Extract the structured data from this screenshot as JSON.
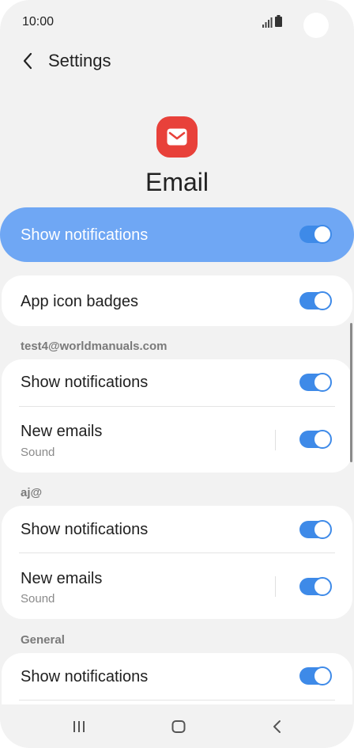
{
  "status_bar": {
    "time": "10:00"
  },
  "header": {
    "title": "Settings"
  },
  "app": {
    "name": "Email"
  },
  "master": {
    "label": "Show notifications",
    "enabled": true
  },
  "badges": {
    "label": "App icon badges",
    "enabled": true
  },
  "sections": [
    {
      "header": "test4@worldmanuals.com",
      "rows": [
        {
          "title": "Show notifications",
          "enabled": true
        },
        {
          "title": "New emails",
          "subtitle": "Sound",
          "enabled": true
        }
      ]
    },
    {
      "header": "aj@",
      "rows": [
        {
          "title": "Show notifications",
          "enabled": true
        },
        {
          "title": "New emails",
          "subtitle": "Sound",
          "enabled": true
        }
      ]
    },
    {
      "header": "General",
      "rows": [
        {
          "title": "Show notifications",
          "enabled": true
        }
      ]
    }
  ],
  "colors": {
    "accent": "#3e8ae8",
    "master_bg": "#6fa7f4",
    "app_icon": "#e8413a"
  },
  "icons": {
    "back": "back-arrow-icon",
    "recents": "recents-icon",
    "home": "home-icon",
    "nav_back": "nav-back-icon"
  }
}
